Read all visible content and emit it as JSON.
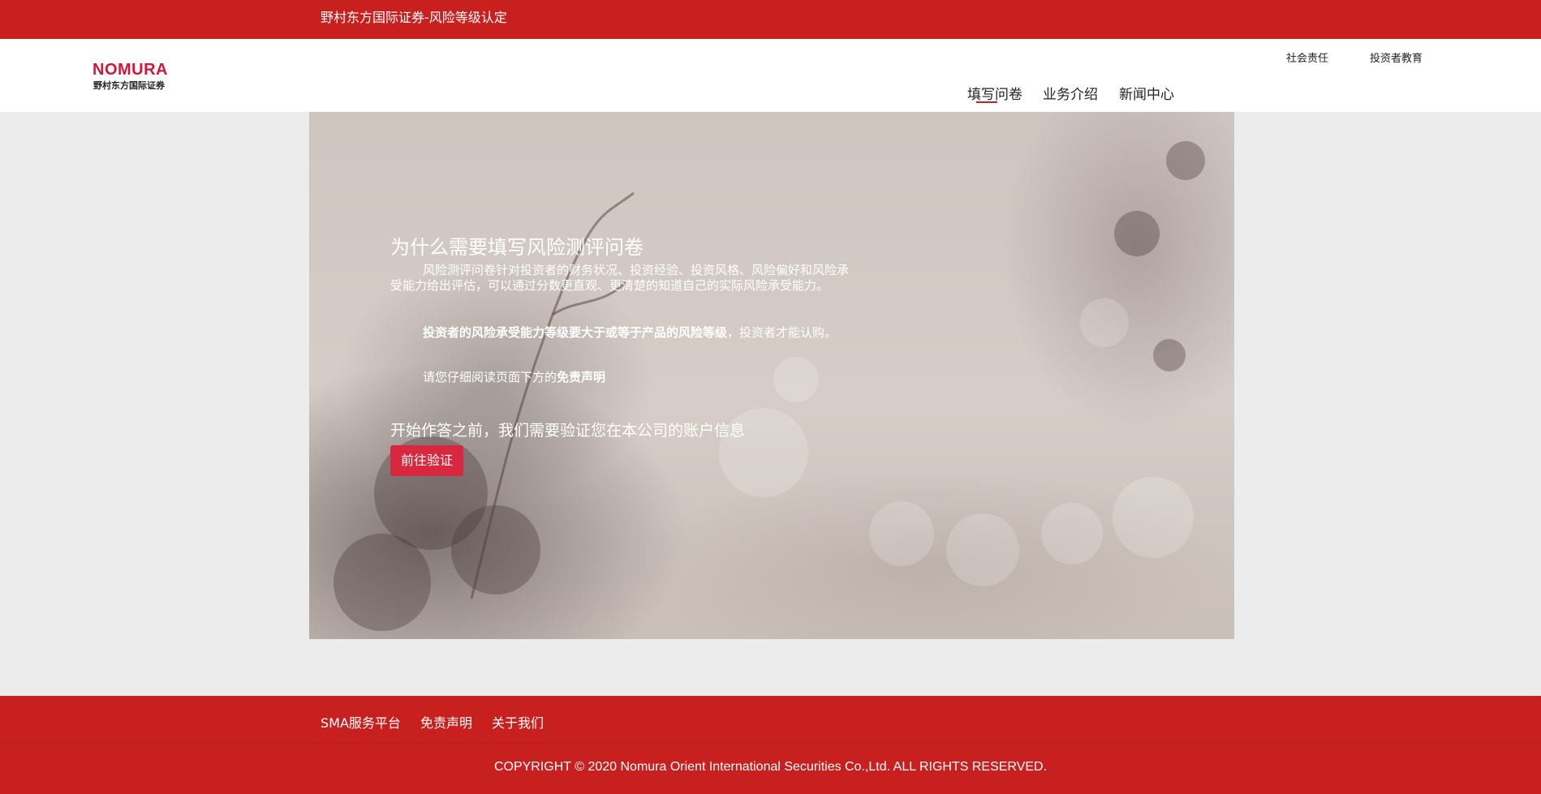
{
  "topbar": {
    "title": "野村东方国际证券-风险等级认定"
  },
  "header": {
    "logo": {
      "mark": "NOMURA",
      "subtitle": "野村东方国际证券"
    },
    "utility_links": [
      "社会责任",
      "投资者教育"
    ],
    "nav": {
      "items": [
        "填写问卷",
        "业务介绍",
        "新闻中心"
      ],
      "active": "填写问卷"
    }
  },
  "hero": {
    "title": "为什么需要填写风险测评问卷",
    "paragraph1": "风险测评问卷针对投资者的财务状况、投资经验、投资风格、风险偏好和风险承受能力给出评估，可以通过分数更直观、更清楚的知道自己的实际风险承受能力。",
    "paragraph2_bold": "投资者的风险承受能力等级要大于或等于产品的风险等级",
    "paragraph2_rest": "，投资者才能认购。",
    "paragraph3_prefix": "请您仔细阅读页面下方的",
    "paragraph3_bold": "免责声明",
    "verify_prompt": "开始作答之前，我们需要验证您在本公司的账户信息",
    "verify_button": "前往验证"
  },
  "footer": {
    "links": [
      "SMA服务平台",
      "免责声明",
      "关于我们"
    ],
    "copyright": "COPYRIGHT © 2020 Nomura Orient International Securities Co.,Ltd. ALL RIGHTS RESERVED."
  },
  "colors": {
    "brand_red": "#c8201f",
    "button_red": "#d8273e",
    "logo_red": "#d0173a"
  }
}
